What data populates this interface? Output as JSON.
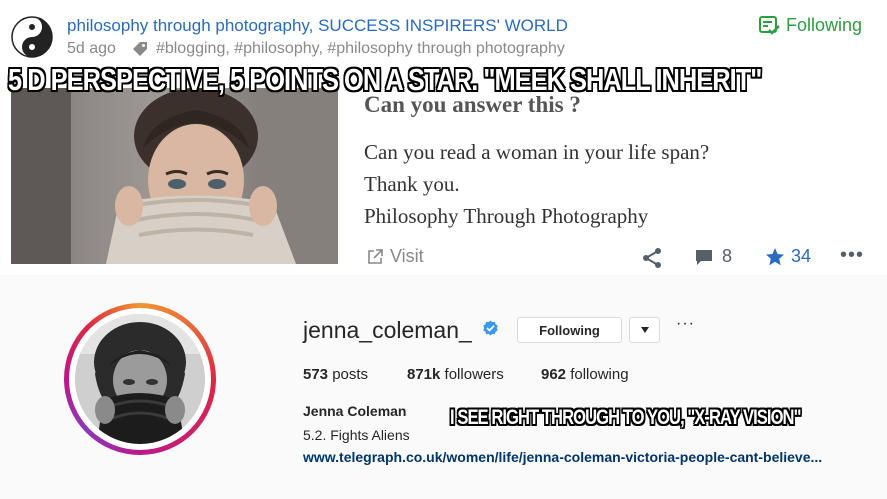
{
  "post": {
    "channel_title": "philosophy through photography, SUCCESS INSPIRERS' WORLD",
    "age": "5d ago",
    "tags": "#blogging, #philosophy, #philosophy through photography",
    "follow_status": "Following",
    "question_title": "Can you answer this ?",
    "body_lines": [
      "Can you read a woman in your life span?",
      "Thank you.",
      "Philosophy Through Photography"
    ],
    "visit_label": "Visit",
    "comment_count": "8",
    "star_count": "34",
    "more_label": "•••"
  },
  "profile": {
    "username": "jenna_coleman_",
    "follow_button": "Following",
    "options_label": "···",
    "posts_count": "573",
    "posts_label": "posts",
    "followers_count": "871k",
    "followers_label": "followers",
    "following_count": "962",
    "following_label": "following",
    "full_name": "Jenna Coleman",
    "bio": "5.2. Fights Aliens",
    "link": "www.telegraph.co.uk/women/life/jenna-coleman-victoria-people-cant-believe..."
  },
  "captions": {
    "top": "5 D PERSPECTIVE, 5 POINTS ON A STAR. \"MEEK SHALL INHERIT\"",
    "bottom": "I SEE RIGHT THROUGH TO YOU, \"X-RAY VISION\""
  },
  "icons": {
    "channel": "yin-yang-icon",
    "tag": "tag-icon",
    "following": "check-list-icon",
    "visit": "external-link-icon",
    "share": "share-icon",
    "comment": "comment-icon",
    "star": "star-icon",
    "verified": "verified-badge-icon",
    "dropdown": "caret-down-icon"
  },
  "colors": {
    "link_blue": "#2a6bbf",
    "following_green": "#2e9d3e",
    "instagram_link": "#003569",
    "verified_blue": "#3897f0"
  }
}
